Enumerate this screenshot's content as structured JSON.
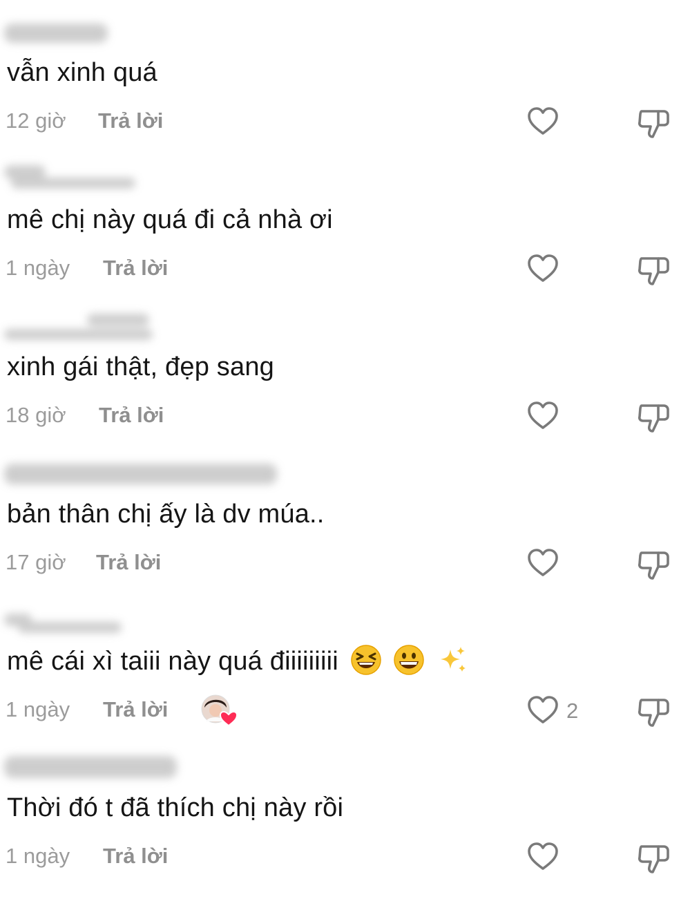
{
  "comments": [
    {
      "text": "vẫn xinh quá",
      "time": "12 giờ",
      "reply_label": "Trả lời",
      "like_count": ""
    },
    {
      "text": "mê chị này quá đi cả nhà ơi",
      "time": "1 ngày",
      "reply_label": "Trả lời",
      "like_count": ""
    },
    {
      "text": "xinh gái thật, đẹp sang",
      "time": "18 giờ",
      "reply_label": "Trả lời",
      "like_count": ""
    },
    {
      "text": "bản thân chị ấy là dv múa..",
      "time": "17 giờ",
      "reply_label": "Trả lời",
      "like_count": ""
    },
    {
      "text": "mê cái xì taiii này quá điiiiiiiii",
      "time": "1 ngày",
      "reply_label": "Trả lời",
      "like_count": "2",
      "emojis": [
        "laughing-squint-emoji",
        "grinning-emoji",
        "sparkles-emoji"
      ],
      "creator_liked": true
    },
    {
      "text": "Thời đó t đã thích chị này rồi",
      "time": "1 ngày",
      "reply_label": "Trả lời",
      "like_count": ""
    }
  ],
  "icons": {
    "like": "heart-outline-icon",
    "dislike": "thumbs-down-outline-icon",
    "creator_like": "creator-liked-avatar-heart"
  },
  "colors": {
    "text": "#151515",
    "meta": "#9b9b9b",
    "icon": "#7a7a7a",
    "creator_heart": "#fe2c55"
  }
}
